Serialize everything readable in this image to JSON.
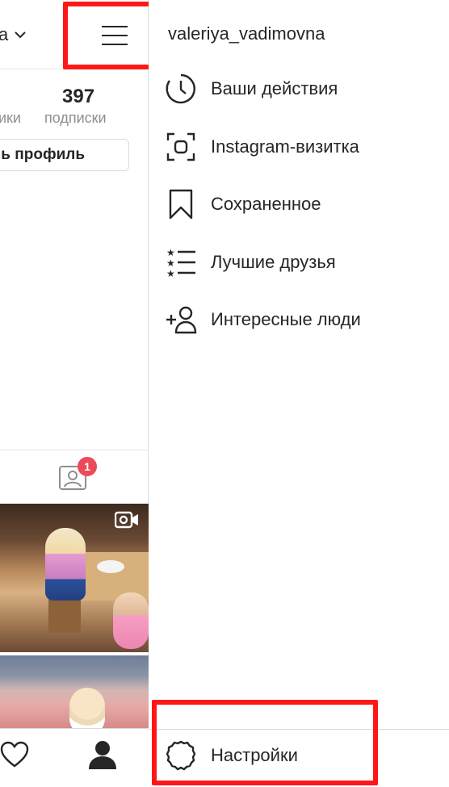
{
  "profile": {
    "username_truncated": "a",
    "stats": {
      "following_count": "397",
      "followers_label_truncated": "ики",
      "following_label": "подписки"
    },
    "edit_profile_label_truncated": "ь профиль",
    "tagged_badge_count": "1"
  },
  "drawer": {
    "username": "valeriya_vadimovna",
    "items": [
      {
        "icon": "activity-icon",
        "label": "Ваши действия"
      },
      {
        "icon": "nametag-icon",
        "label": "Instagram-визитка"
      },
      {
        "icon": "bookmark-icon",
        "label": "Сохраненное"
      },
      {
        "icon": "close-friends-icon",
        "label": "Лучшие друзья"
      },
      {
        "icon": "discover-people-icon",
        "label": "Интересные люди"
      }
    ],
    "settings_label": "Настройки"
  },
  "colors": {
    "highlight": "#ff1717",
    "badge": "#ed4956",
    "text": "#262626",
    "muted": "#8e8e8e",
    "border": "#dbdbdb"
  }
}
